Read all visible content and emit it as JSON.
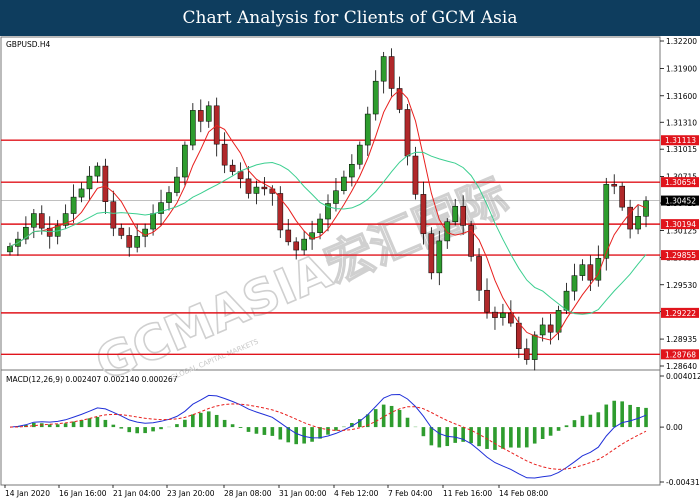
{
  "banner": {
    "title": "Chart Analysis for Clients of GCM Asia"
  },
  "watermark": {
    "brand": "GCMASIA宏汇国际",
    "sub": "GLOBAL CAPITAL MARKETS"
  },
  "colors": {
    "banner_bg": "#0e3d5e",
    "bull": "#2e9c2e",
    "bear": "#b0282a",
    "level": "#e0141c",
    "ma_fast": "#e8201e",
    "ma_slow": "#3ccf90",
    "macd_line": "#2030d8",
    "macd_signal": "#e8201e",
    "macd_hist": "#2e9c2e"
  },
  "chart_data": [
    {
      "type": "candlestick",
      "symbol": "GBPUSD.H4",
      "x_tick_labels": [
        "14 Jan 2020",
        "16 Jan 16:00",
        "21 Jan 04:00",
        "23 Jan 20:00",
        "28 Jan 08:00",
        "31 Jan 00:00",
        "4 Feb 12:00",
        "7 Feb 04:00",
        "11 Feb 16:00",
        "14 Feb 08:00"
      ],
      "y_tick_labels": [
        "1.32200",
        "1.31900",
        "1.31600",
        "1.31310",
        "1.31015",
        "1.30715",
        "1.30425",
        "1.30125",
        "1.29830",
        "1.29530",
        "1.29235",
        "1.28935",
        "1.28640"
      ],
      "ylim": [
        1.2864,
        1.322
      ],
      "horizontal_levels": [
        1.31113,
        1.30654,
        1.30194,
        1.29855,
        1.29222,
        1.28768
      ],
      "current_price": 1.30452,
      "close_path": [
        1.2995,
        1.3003,
        1.3016,
        1.3031,
        1.3015,
        1.3006,
        1.3018,
        1.3031,
        1.3049,
        1.3058,
        1.3072,
        1.3083,
        1.3044,
        1.3015,
        1.3007,
        1.2994,
        1.3006,
        1.3014,
        1.3031,
        1.3043,
        1.3054,
        1.3071,
        1.3106,
        1.3144,
        1.3132,
        1.3149,
        1.3107,
        1.3084,
        1.3077,
        1.3069,
        1.3053,
        1.306,
        1.3058,
        1.3053,
        1.3013,
        1.3,
        1.2991,
        1.3003,
        1.301,
        1.3025,
        1.3042,
        1.3056,
        1.3071,
        1.3085,
        1.3106,
        1.314,
        1.3176,
        1.3203,
        1.3168,
        1.3145,
        1.3094,
        1.3052,
        1.3009,
        1.2966,
        1.3001,
        1.3022,
        1.3039,
        1.3018,
        1.2984,
        1.2947,
        1.2923,
        1.2917,
        1.2922,
        1.2911,
        1.2883,
        1.2871,
        1.2898,
        1.2909,
        1.2901,
        1.2925,
        1.2946,
        1.2963,
        1.2975,
        1.2958,
        1.2982,
        1.3063,
        1.3061,
        1.3038,
        1.3014,
        1.3028,
        1.3045
      ]
    },
    {
      "type": "macd",
      "title": "MACD(12,26,9) 0.002407 0.002140 0.000267",
      "y_tick_labels": [
        "0.004012",
        "0.00",
        "-0.004311"
      ],
      "ylim": [
        -0.004311,
        0.004012
      ]
    }
  ],
  "right_tags": [
    "1.31113",
    "1.30654",
    "1.30452",
    "1.30194",
    "1.29855",
    "1.29222",
    "1.28768"
  ]
}
